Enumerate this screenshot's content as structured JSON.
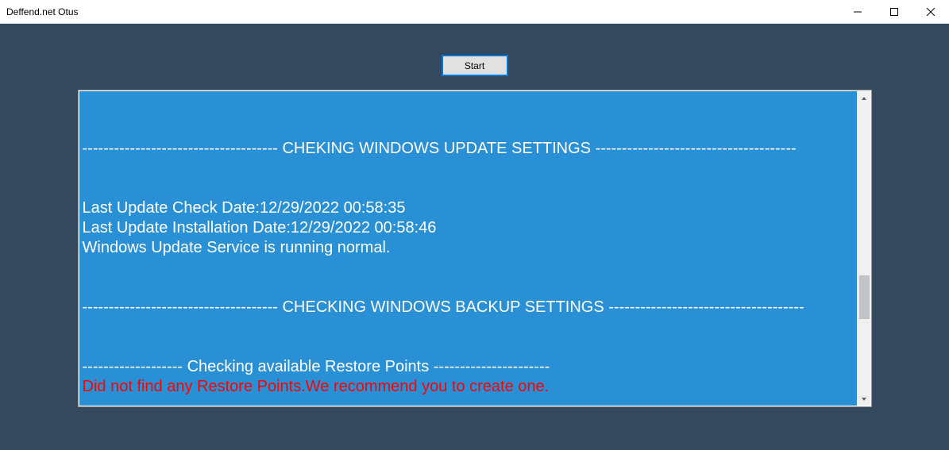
{
  "window": {
    "title": "Deffend.net Otus"
  },
  "toolbar": {
    "start_label": "Start"
  },
  "console": {
    "lines": [
      {
        "text": "",
        "color": "white"
      },
      {
        "text": "",
        "color": "white"
      },
      {
        "text": "------------------------------------- CHEKING WINDOWS UPDATE SETTINGS --------------------------------------",
        "color": "white"
      },
      {
        "text": "",
        "color": "white"
      },
      {
        "text": "",
        "color": "white"
      },
      {
        "text": "Last Update Check Date:12/29/2022 00:58:35",
        "color": "white"
      },
      {
        "text": "Last Update Installation Date:12/29/2022 00:58:46",
        "color": "white"
      },
      {
        "text": "Windows Update Service is running normal.",
        "color": "white"
      },
      {
        "text": "",
        "color": "white"
      },
      {
        "text": "",
        "color": "white"
      },
      {
        "text": "------------------------------------- CHECKING WINDOWS BACKUP SETTINGS -------------------------------------",
        "color": "white"
      },
      {
        "text": "",
        "color": "white"
      },
      {
        "text": "",
        "color": "white"
      },
      {
        "text": "------------------- Checking available Restore Points ----------------------",
        "color": "white"
      },
      {
        "text": "Did not find any Restore Points.We recommend you to create one.",
        "color": "red"
      }
    ]
  }
}
